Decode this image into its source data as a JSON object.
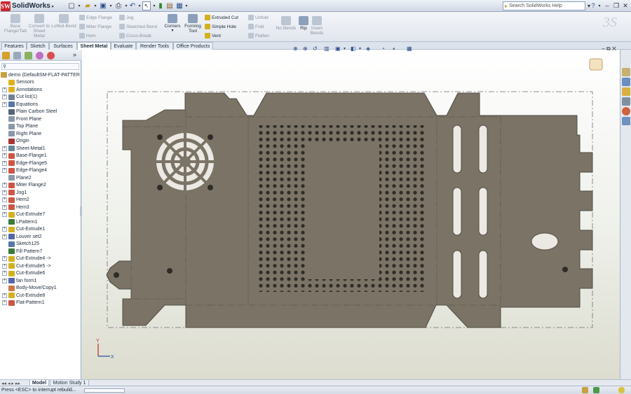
{
  "app": {
    "name": "SolidWorks",
    "logo_text": "SW"
  },
  "search": {
    "placeholder": "Search SolidWorks Help"
  },
  "ribbon": {
    "base_flange": "Base Flange/Tab",
    "convert": "Convert to Sheet Metal",
    "lofted_bend": "Lofted-Bend",
    "edge_flange": "Edge Flange",
    "miter_flange": "Miter Flange",
    "hem": "Hem",
    "jog": "Jog",
    "sketched_bend": "Sketched Bend",
    "cross_break": "Cross-Break",
    "corners": "Corners",
    "forming_tool": "Forming Tool",
    "extruded_cut": "Extruded Cut",
    "simple_hole": "Simple Hole",
    "vent": "Vent",
    "unfold": "Unfold",
    "fold": "Fold",
    "flatten": "Flatten",
    "no_bends": "No Bends",
    "rip": "Rip",
    "insert_bends": "Insert Bends"
  },
  "tabs": [
    "Features",
    "Sketch",
    "Surfaces",
    "Sheet Metal",
    "Evaluate",
    "Render Tools",
    "Office Products"
  ],
  "tree": [
    {
      "label": "demo  (DefaultSM-FLAT-PATTER",
      "icon": "part",
      "exp": "",
      "color": "#c8a040"
    },
    {
      "label": "Sensors",
      "icon": "sensor",
      "exp": "",
      "color": "#e0b020"
    },
    {
      "label": "Annotations",
      "icon": "annotation",
      "exp": "+",
      "color": "#e0b020"
    },
    {
      "label": "Cut list(1)",
      "icon": "cutlist",
      "exp": "+",
      "color": "#708090"
    },
    {
      "label": "Equations",
      "icon": "equation",
      "exp": "+",
      "color": "#5577aa"
    },
    {
      "label": "Plain Carbon Steel",
      "icon": "material",
      "exp": "",
      "color": "#556677"
    },
    {
      "label": "Front Plane",
      "icon": "plane",
      "exp": "",
      "color": "#8899aa"
    },
    {
      "label": "Top Plane",
      "icon": "plane",
      "exp": "",
      "color": "#8899aa"
    },
    {
      "label": "Right Plane",
      "icon": "plane",
      "exp": "",
      "color": "#8899aa"
    },
    {
      "label": "Origin",
      "icon": "origin",
      "exp": "",
      "color": "#aa3333"
    },
    {
      "label": "Sheet-Metal1",
      "icon": "sheet-metal",
      "exp": "+",
      "color": "#668899"
    },
    {
      "label": "Base-Flange1",
      "icon": "flange",
      "exp": "+",
      "color": "#cc5544"
    },
    {
      "label": "Edge-Flange5",
      "icon": "flange",
      "exp": "+",
      "color": "#cc5544"
    },
    {
      "label": "Edge-Flange4",
      "icon": "flange",
      "exp": "+",
      "color": "#cc5544"
    },
    {
      "label": "Plane2",
      "icon": "plane",
      "exp": "",
      "color": "#8899aa"
    },
    {
      "label": "Miter Flange2",
      "icon": "flange",
      "exp": "+",
      "color": "#cc5544"
    },
    {
      "label": "Jog1",
      "icon": "jog",
      "exp": "+",
      "color": "#cc5544"
    },
    {
      "label": "Hem2",
      "icon": "hem",
      "exp": "+",
      "color": "#cc5544"
    },
    {
      "label": "Hem3",
      "icon": "hem",
      "exp": "+",
      "color": "#cc5544"
    },
    {
      "label": "Cut-Extrude7",
      "icon": "cut",
      "exp": "+",
      "color": "#d4b020"
    },
    {
      "label": "LPattern1",
      "icon": "pattern",
      "exp": "",
      "color": "#3a7a3a"
    },
    {
      "label": "Cut-Extrude1",
      "icon": "cut",
      "exp": "+",
      "color": "#d4b020"
    },
    {
      "label": "Louver set2",
      "icon": "louver",
      "exp": "+",
      "color": "#5566aa"
    },
    {
      "label": "Sketch125",
      "icon": "sketch",
      "exp": "",
      "color": "#5577aa"
    },
    {
      "label": "Fill Pattern7",
      "icon": "pattern",
      "exp": "",
      "color": "#3a7a3a"
    },
    {
      "label": "Cut-Extrude4 ->",
      "icon": "cut",
      "exp": "+",
      "color": "#d4b020"
    },
    {
      "label": "Cut-Extrude5 ->",
      "icon": "cut",
      "exp": "+",
      "color": "#d4b020"
    },
    {
      "label": "Cut-Extrude6",
      "icon": "cut",
      "exp": "+",
      "color": "#d4b020"
    },
    {
      "label": "fan form1",
      "icon": "form",
      "exp": "+",
      "color": "#5566aa"
    },
    {
      "label": "Body-Move/Copy1",
      "icon": "move",
      "exp": "",
      "color": "#cc7744"
    },
    {
      "label": "Cut-Extrude8",
      "icon": "cut",
      "exp": "+",
      "color": "#d4b020"
    },
    {
      "label": "Flat-Pattern1",
      "icon": "flat-pattern",
      "exp": "+",
      "color": "#cc5544"
    }
  ],
  "bottom_tabs": [
    "Model",
    "Motion Study 1"
  ],
  "status": {
    "text": "Press <ESC> to interrupt rebuild..."
  },
  "colors": {
    "sheet": "#7a7365",
    "sheet_edge": "#5b554b",
    "accent": "#2b4f8a",
    "highlight": "#3b6fd1"
  }
}
